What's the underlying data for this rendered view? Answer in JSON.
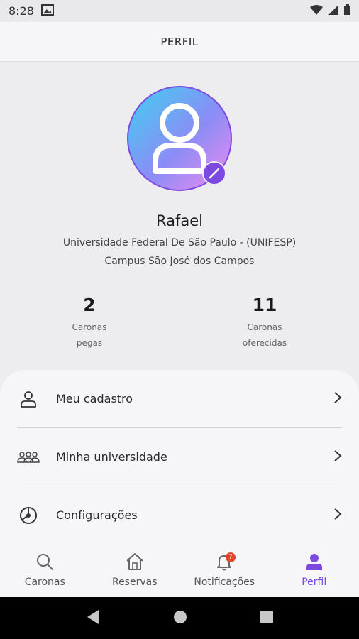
{
  "status_bar": {
    "time": "8:28"
  },
  "header": {
    "title": "PERFIL"
  },
  "profile": {
    "name": "Rafael",
    "university": "Universidade Federal De São Paulo - (UNIFESP)",
    "campus": "Campus São José dos Campos",
    "stats": [
      {
        "value": "2",
        "label_line1": "Caronas",
        "label_line2": "pegas"
      },
      {
        "value": "11",
        "label_line1": "Caronas",
        "label_line2": "oferecidas"
      }
    ]
  },
  "menu": {
    "items": [
      {
        "label": "Meu cadastro",
        "icon": "person-outline-icon"
      },
      {
        "label": "Minha universidade",
        "icon": "group-icon"
      },
      {
        "label": "Configurações",
        "icon": "settings-icon"
      }
    ]
  },
  "bottom_nav": {
    "items": [
      {
        "label": "Caronas",
        "icon": "search-icon"
      },
      {
        "label": "Reservas",
        "icon": "home-icon"
      },
      {
        "label": "Notificações",
        "icon": "bell-icon",
        "badge": "7"
      },
      {
        "label": "Perfil",
        "icon": "person-icon",
        "active": true
      }
    ]
  },
  "colors": {
    "accent": "#7c4ae0",
    "badge": "#e2452c"
  }
}
